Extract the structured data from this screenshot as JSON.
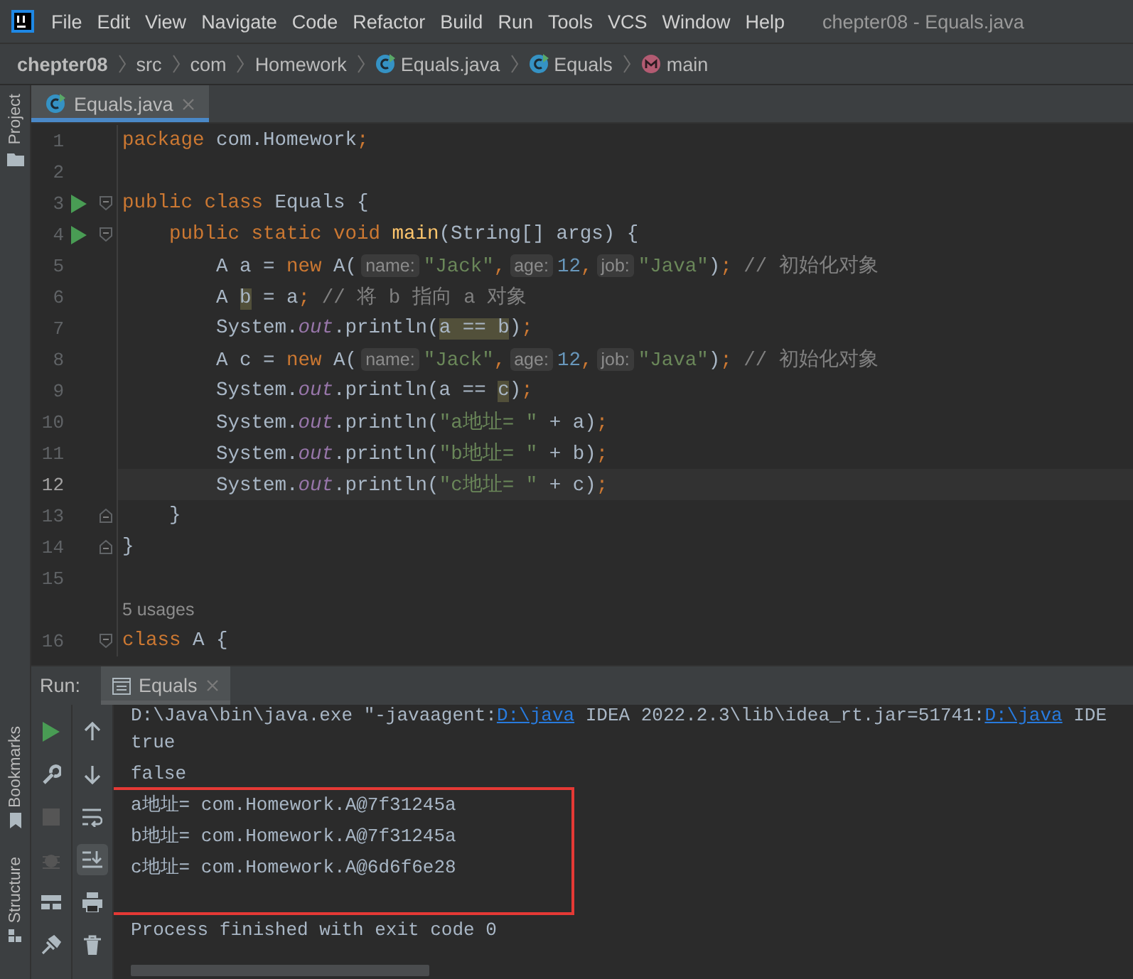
{
  "menu_bar": {
    "items": [
      "File",
      "Edit",
      "View",
      "Navigate",
      "Code",
      "Refactor",
      "Build",
      "Run",
      "Tools",
      "VCS",
      "Window",
      "Help"
    ],
    "title": "chepter08 - Equals.java"
  },
  "breadcrumbs": [
    {
      "label": "chepter08",
      "kind": "project"
    },
    {
      "label": "src",
      "kind": "folder"
    },
    {
      "label": "com",
      "kind": "folder"
    },
    {
      "label": "Homework",
      "kind": "folder"
    },
    {
      "label": "Equals.java",
      "kind": "class"
    },
    {
      "label": "Equals",
      "kind": "class"
    },
    {
      "label": "main",
      "kind": "method"
    }
  ],
  "tool_strip": {
    "top": [
      "Project"
    ],
    "bottom": [
      "Bookmarks",
      "Structure"
    ]
  },
  "editor_tabs": [
    {
      "label": "Equals.java",
      "selected": true
    }
  ],
  "editor": {
    "lines": [
      {
        "kind": "code",
        "number": "1",
        "current": false,
        "run": false,
        "tokens": [
          {
            "t": "package",
            "kind": "kw"
          },
          {
            "t": " com.Homework",
            "kind": "plain"
          },
          {
            "t": ";",
            "kind": "kw"
          }
        ]
      },
      {
        "kind": "code",
        "number": "2",
        "current": false,
        "run": false
      },
      {
        "kind": "code",
        "number": "3",
        "current": false,
        "run": true,
        "fold": {
          "kind": "start"
        },
        "tokens": [
          {
            "t": "public class",
            "kind": "kw"
          },
          {
            "t": " Equals {",
            "kind": "plain"
          }
        ]
      },
      {
        "kind": "code",
        "number": "4",
        "current": false,
        "run": true,
        "fold": {
          "kind": "start"
        },
        "tokens": [
          {
            "t": "    public static void ",
            "kind": "kw"
          },
          {
            "t": "main",
            "kind": "method"
          },
          {
            "t": "(String[] args) {",
            "kind": "plain"
          }
        ]
      },
      {
        "kind": "code",
        "number": "5",
        "current": false,
        "run": false,
        "tokens": [
          {
            "t": "        A a = ",
            "kind": "plain"
          },
          {
            "t": "new",
            "kind": "kw"
          },
          {
            "t": " A(",
            "kind": "plain"
          },
          {
            "t": "name:",
            "kind": "hint"
          },
          {
            "t": "\"Jack\"",
            "kind": "str"
          },
          {
            "t": ",",
            "kind": "kw"
          },
          {
            "t": "age:",
            "kind": "hint"
          },
          {
            "t": "12",
            "kind": "num"
          },
          {
            "t": ",",
            "kind": "kw"
          },
          {
            "t": "job:",
            "kind": "hint"
          },
          {
            "t": "\"Java\"",
            "kind": "str"
          },
          {
            "t": ")",
            "kind": "plain"
          },
          {
            "t": ";",
            "kind": "kw"
          },
          {
            "t": " // 初始化对象",
            "kind": "comment"
          }
        ]
      },
      {
        "kind": "code",
        "number": "6",
        "current": false,
        "run": false,
        "tokens": [
          {
            "t": "        A ",
            "kind": "plain"
          },
          {
            "t": "b",
            "kind": "hl"
          },
          {
            "t": " = a",
            "kind": "plain"
          },
          {
            "t": ";",
            "kind": "kw"
          },
          {
            "t": " // 将 b 指向 a 对象",
            "kind": "comment"
          }
        ]
      },
      {
        "kind": "code",
        "number": "7",
        "current": false,
        "run": false,
        "tokens": [
          {
            "t": "        System.",
            "kind": "plain"
          },
          {
            "t": "out",
            "kind": "field"
          },
          {
            "t": ".println(",
            "kind": "plain"
          },
          {
            "t": "a == b",
            "kind": "hl"
          },
          {
            "t": ")",
            "kind": "plain"
          },
          {
            "t": ";",
            "kind": "kw"
          }
        ]
      },
      {
        "kind": "code",
        "number": "8",
        "current": false,
        "run": false,
        "tokens": [
          {
            "t": "        A c = ",
            "kind": "plain"
          },
          {
            "t": "new",
            "kind": "kw"
          },
          {
            "t": " A(",
            "kind": "plain"
          },
          {
            "t": "name:",
            "kind": "hint"
          },
          {
            "t": "\"Jack\"",
            "kind": "str"
          },
          {
            "t": ",",
            "kind": "kw"
          },
          {
            "t": "age:",
            "kind": "hint"
          },
          {
            "t": "12",
            "kind": "num"
          },
          {
            "t": ",",
            "kind": "kw"
          },
          {
            "t": "job:",
            "kind": "hint"
          },
          {
            "t": "\"Java\"",
            "kind": "str"
          },
          {
            "t": ")",
            "kind": "plain"
          },
          {
            "t": ";",
            "kind": "kw"
          },
          {
            "t": " // 初始化对象",
            "kind": "comment"
          }
        ]
      },
      {
        "kind": "code",
        "number": "9",
        "current": false,
        "run": false,
        "tokens": [
          {
            "t": "        System.",
            "kind": "plain"
          },
          {
            "t": "out",
            "kind": "field"
          },
          {
            "t": ".println(a == ",
            "kind": "plain"
          },
          {
            "t": "c",
            "kind": "hl"
          },
          {
            "t": ")",
            "kind": "plain"
          },
          {
            "t": ";",
            "kind": "kw"
          }
        ]
      },
      {
        "kind": "code",
        "number": "10",
        "current": false,
        "run": false,
        "tokens": [
          {
            "t": "        System.",
            "kind": "plain"
          },
          {
            "t": "out",
            "kind": "field"
          },
          {
            "t": ".println(",
            "kind": "plain"
          },
          {
            "t": "\"a地址= \"",
            "kind": "str"
          },
          {
            "t": " + a)",
            "kind": "plain"
          },
          {
            "t": ";",
            "kind": "kw"
          }
        ]
      },
      {
        "kind": "code",
        "number": "11",
        "current": false,
        "run": false,
        "tokens": [
          {
            "t": "        System.",
            "kind": "plain"
          },
          {
            "t": "out",
            "kind": "field"
          },
          {
            "t": ".println(",
            "kind": "plain"
          },
          {
            "t": "\"b地址= \"",
            "kind": "str"
          },
          {
            "t": " + b)",
            "kind": "plain"
          },
          {
            "t": ";",
            "kind": "kw"
          }
        ]
      },
      {
        "kind": "code",
        "number": "12",
        "current": true,
        "run": false,
        "tokens": [
          {
            "t": "        System.",
            "kind": "plain"
          },
          {
            "t": "out",
            "kind": "field"
          },
          {
            "t": ".println(",
            "kind": "plain"
          },
          {
            "t": "\"c地址= \"",
            "kind": "str"
          },
          {
            "t": " + c)",
            "kind": "plain"
          },
          {
            "t": ";",
            "kind": "kw"
          }
        ]
      },
      {
        "kind": "code",
        "number": "13",
        "current": false,
        "run": false,
        "fold": {
          "kind": "end"
        },
        "tokens": [
          {
            "t": "    }",
            "kind": "plain"
          }
        ]
      },
      {
        "kind": "code",
        "number": "14",
        "current": false,
        "run": false,
        "fold": {
          "kind": "end"
        },
        "tokens": [
          {
            "t": "}",
            "kind": "plain"
          }
        ]
      },
      {
        "kind": "code",
        "number": "15",
        "current": false,
        "run": false
      },
      {
        "kind": "inlay",
        "text": "5 usages"
      },
      {
        "kind": "code",
        "number": "16",
        "current": false,
        "run": false,
        "fold": {
          "kind": "start"
        },
        "tokens": [
          {
            "t": "class",
            "kind": "kw"
          },
          {
            "t": " A {",
            "kind": "plain"
          }
        ]
      }
    ]
  },
  "run_panel": {
    "label": "Run:",
    "tabs": [
      {
        "label": "Equals",
        "selected": true
      }
    ],
    "console": [
      {
        "kind": "line",
        "tokens": [
          {
            "t": "D:\\Java\\bin\\java.exe \"-javaagent:",
            "kind": "plain"
          },
          {
            "t": "D:\\java",
            "kind": "link"
          },
          {
            "t": " IDEA 2022.2.3\\lib\\idea_rt.jar=51741:",
            "kind": "plain"
          },
          {
            "t": "D:\\java",
            "kind": "link"
          },
          {
            "t": " IDE",
            "kind": "plain"
          }
        ]
      },
      {
        "kind": "line",
        "tokens": [
          {
            "t": "true",
            "kind": "plain"
          }
        ]
      },
      {
        "kind": "line",
        "tokens": [
          {
            "t": "false",
            "kind": "plain"
          }
        ]
      },
      {
        "kind": "frame",
        "lines": [
          "a地址= com.Homework.A@7f31245a",
          "b地址= com.Homework.A@7f31245a",
          "c地址= com.Homework.A@6d6f6e28"
        ]
      },
      {
        "kind": "line",
        "tokens": [
          {
            "t": "Process finished with exit code 0",
            "kind": "plain"
          }
        ]
      }
    ]
  }
}
